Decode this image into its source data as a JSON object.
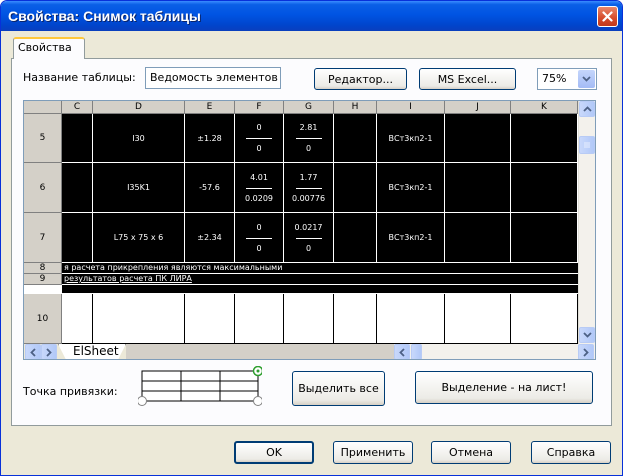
{
  "window": {
    "title": "Свойства: Снимок таблицы"
  },
  "tabs": [
    "Свойства"
  ],
  "name_row": {
    "label": "Название таблицы:",
    "value": "Ведомость элементов",
    "editor_button": "Редактор...",
    "excel_button": "MS Excel...",
    "zoom": "75%"
  },
  "sheet": {
    "columns": [
      "C",
      "D",
      "E",
      "F",
      "G",
      "H",
      "I",
      "J",
      "K"
    ],
    "rows": [
      {
        "num": "5",
        "D": "I30",
        "E": "±1.28",
        "F_top": "0",
        "F_bot": "0",
        "G_top": "2.81",
        "G_bot": "0",
        "I": "ВСт3кп2-1"
      },
      {
        "num": "6",
        "D": "I35K1",
        "E": "-57.6",
        "F_top": "4.01",
        "F_bot": "0.0209",
        "G_top": "1.77",
        "G_bot": "0.00776",
        "I": "ВСт3кп2-1"
      },
      {
        "num": "7",
        "D": "L75 x 75 x 6",
        "E": "±2.34",
        "F_top": "0",
        "F_bot": "0",
        "G_top": "0.0217",
        "G_bot": "0",
        "I": "ВСт3кп2-1"
      }
    ],
    "row8": {
      "num": "8",
      "text": "я расчета прикрепления являются максимальными"
    },
    "row9": {
      "num": "9",
      "text": "результатов расчета ПК ЛИРА"
    },
    "row10": {
      "num": "10"
    },
    "sheet_tab": "ElSheet"
  },
  "anchor": {
    "label": "Точка привязки:"
  },
  "buttons": {
    "select_all": "Выделить все",
    "select_to_sheet": "Выделение - на лист!",
    "ok": "OK",
    "apply": "Применить",
    "cancel": "Отмена",
    "help": "Справка"
  }
}
